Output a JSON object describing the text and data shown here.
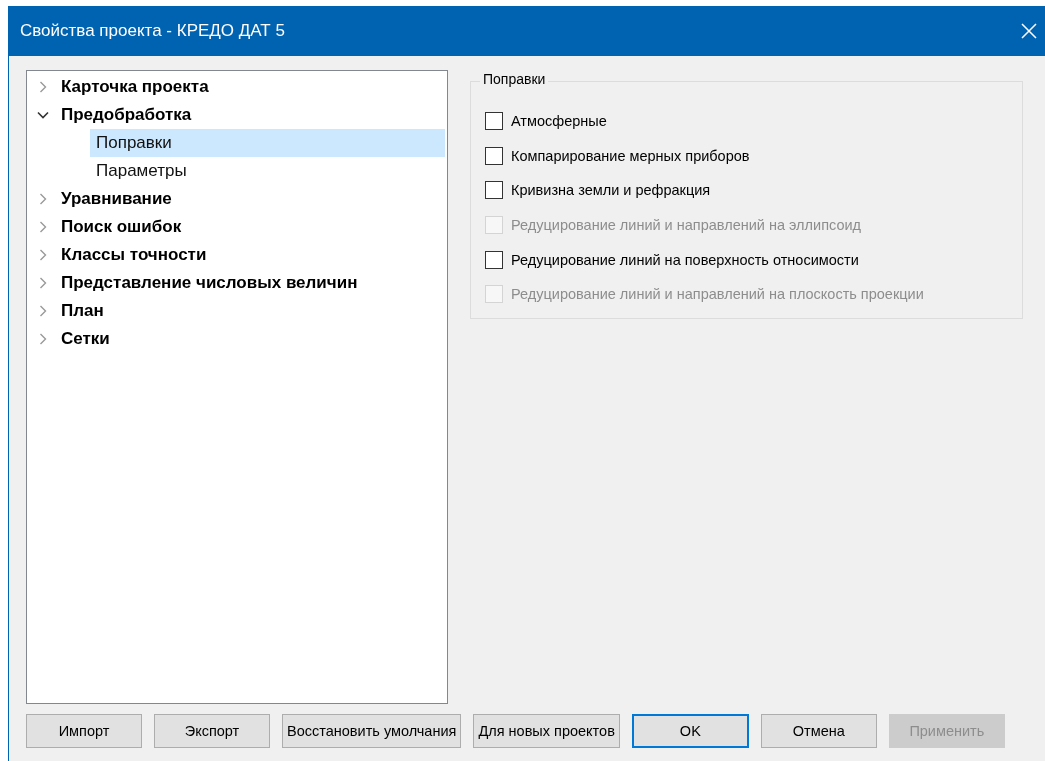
{
  "window": {
    "title": "Свойства проекта - КРЕДО ДАТ 5"
  },
  "tree": [
    {
      "label": "Карточка проекта",
      "expanded": false,
      "selected": false
    },
    {
      "label": "Предобработка",
      "expanded": true,
      "selected": false,
      "children": [
        {
          "label": "Поправки",
          "selected": true
        },
        {
          "label": "Параметры",
          "selected": false
        }
      ]
    },
    {
      "label": "Уравнивание",
      "expanded": false,
      "selected": false
    },
    {
      "label": "Поиск ошибок",
      "expanded": false,
      "selected": false
    },
    {
      "label": "Классы точности",
      "expanded": false,
      "selected": false
    },
    {
      "label": "Представление числовых величин",
      "expanded": false,
      "selected": false
    },
    {
      "label": "План",
      "expanded": false,
      "selected": false
    },
    {
      "label": "Сетки",
      "expanded": false,
      "selected": false
    }
  ],
  "group": {
    "title": "Поправки",
    "options": [
      {
        "label": "Атмосферные",
        "checked": false,
        "disabled": false
      },
      {
        "label": "Компарирование мерных приборов",
        "checked": false,
        "disabled": false
      },
      {
        "label": "Кривизна земли и рефракция",
        "checked": false,
        "disabled": false
      },
      {
        "label": "Редуцирование линий и направлений на эллипсоид",
        "checked": false,
        "disabled": true
      },
      {
        "label": "Редуцирование линий на поверхность относимости",
        "checked": false,
        "disabled": false
      },
      {
        "label": "Редуцирование линий и направлений на плоскость проекции",
        "checked": false,
        "disabled": true
      }
    ]
  },
  "buttons": [
    {
      "label": "Импорт",
      "default": false,
      "disabled": false
    },
    {
      "label": "Экспорт",
      "default": false,
      "disabled": false
    },
    {
      "label": "Восстановить умолчания",
      "default": false,
      "disabled": false
    },
    {
      "label": "Для новых проектов",
      "default": false,
      "disabled": false
    },
    {
      "label": "OK",
      "default": true,
      "disabled": false
    },
    {
      "label": "Отмена",
      "default": false,
      "disabled": false
    },
    {
      "label": "Применить",
      "default": false,
      "disabled": true
    }
  ]
}
